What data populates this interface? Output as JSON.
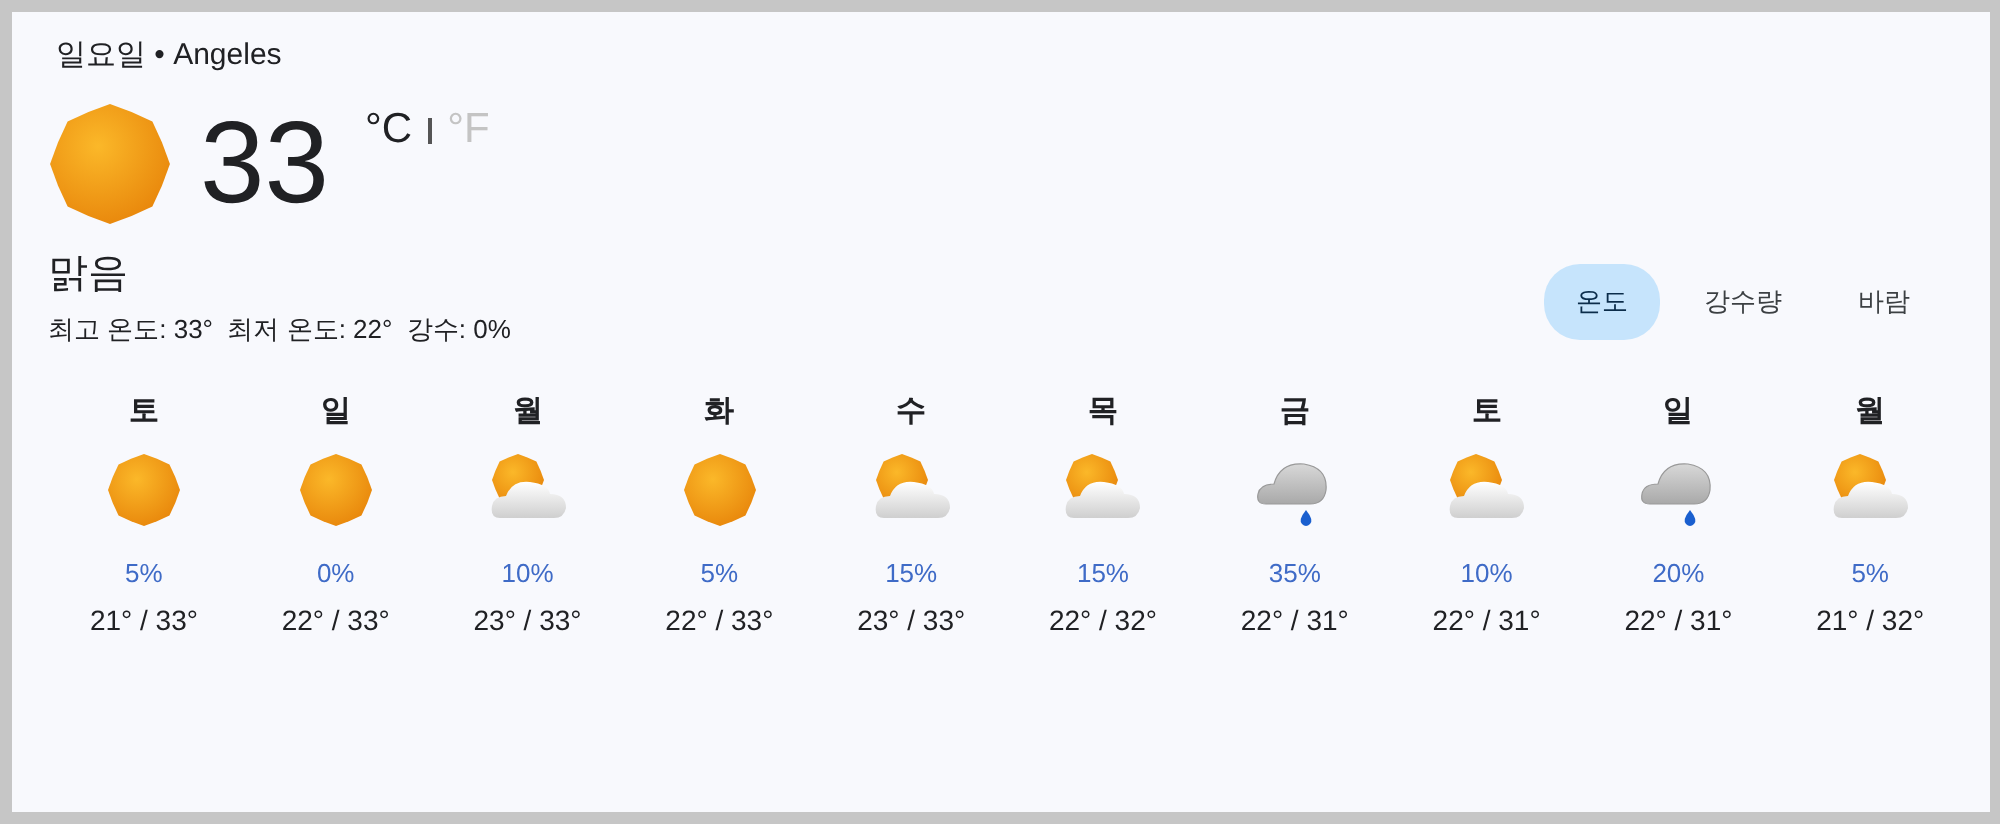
{
  "header": {
    "title": "일요일 • Angeles"
  },
  "current": {
    "kind": "sunny",
    "temperature": "33",
    "condition": "맑음",
    "stats": "최고 온도: 33°  최저 온도: 22°  강수: 0%"
  },
  "units": [
    {
      "label": "°C",
      "selected": true
    },
    {
      "label": "°F",
      "selected": false
    }
  ],
  "tabs": [
    {
      "label": "온도",
      "selected": true
    },
    {
      "label": "강수량",
      "selected": false
    },
    {
      "label": "바람",
      "selected": false
    }
  ],
  "forecast": [
    {
      "day": "토",
      "kind": "sunny",
      "precipitation": "5%",
      "temps": "21° / 33°"
    },
    {
      "day": "일",
      "kind": "sunny",
      "precipitation": "0%",
      "temps": "22° / 33°"
    },
    {
      "day": "월",
      "kind": "partly-cloudy",
      "precipitation": "10%",
      "temps": "23° / 33°"
    },
    {
      "day": "화",
      "kind": "sunny",
      "precipitation": "5%",
      "temps": "22° / 33°"
    },
    {
      "day": "수",
      "kind": "partly-cloudy",
      "precipitation": "15%",
      "temps": "23° / 33°"
    },
    {
      "day": "목",
      "kind": "partly-cloudy",
      "precipitation": "15%",
      "temps": "22° / 32°"
    },
    {
      "day": "금",
      "kind": "rain",
      "precipitation": "35%",
      "temps": "22° / 31°"
    },
    {
      "day": "토",
      "kind": "partly-cloudy",
      "precipitation": "10%",
      "temps": "22° / 31°"
    },
    {
      "day": "일",
      "kind": "rain",
      "precipitation": "20%",
      "temps": "22° / 31°"
    },
    {
      "day": "월",
      "kind": "partly-cloudy",
      "precipitation": "5%",
      "temps": "21° / 32°"
    }
  ]
}
